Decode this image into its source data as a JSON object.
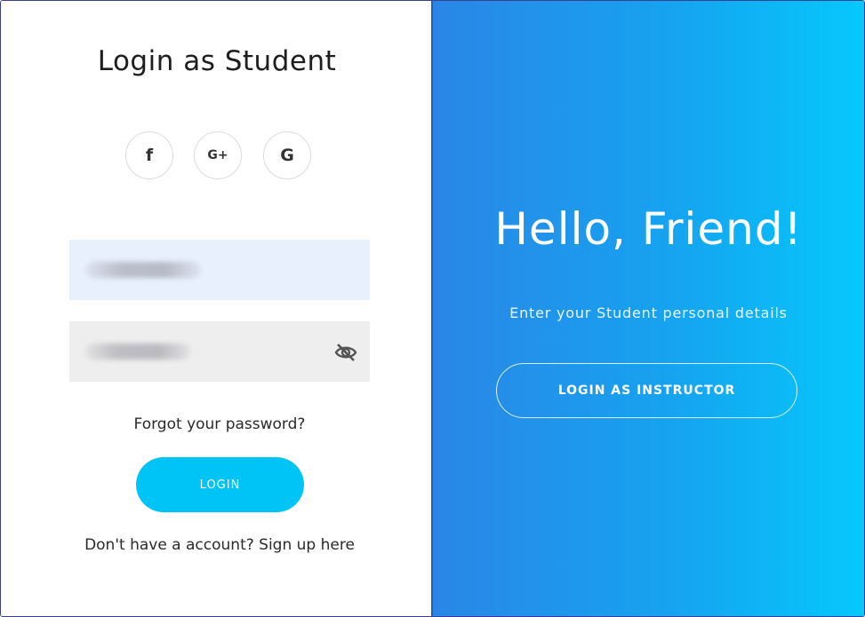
{
  "login": {
    "title": "Login as Student",
    "social": [
      {
        "icon": "facebook-icon",
        "glyph": "f"
      },
      {
        "icon": "google-plus-icon",
        "glyph": "G+"
      },
      {
        "icon": "google-icon",
        "glyph": "G"
      }
    ],
    "forgot_link": "Forgot your password?",
    "login_button": "LOGIN",
    "signup_prompt": "Don't have a account?",
    "signup_link": "Sign up here"
  },
  "promo": {
    "heading": "Hello, Friend!",
    "subtitle": "Enter your Student personal details",
    "instructor_button": "LOGIN AS INSTRUCTOR"
  },
  "colors": {
    "accent": "#00c4f5",
    "gradient_start": "#2a86e6",
    "gradient_end": "#05c8fb",
    "email_field_bg": "#e8f0fe",
    "password_field_bg": "#eeeeee"
  }
}
